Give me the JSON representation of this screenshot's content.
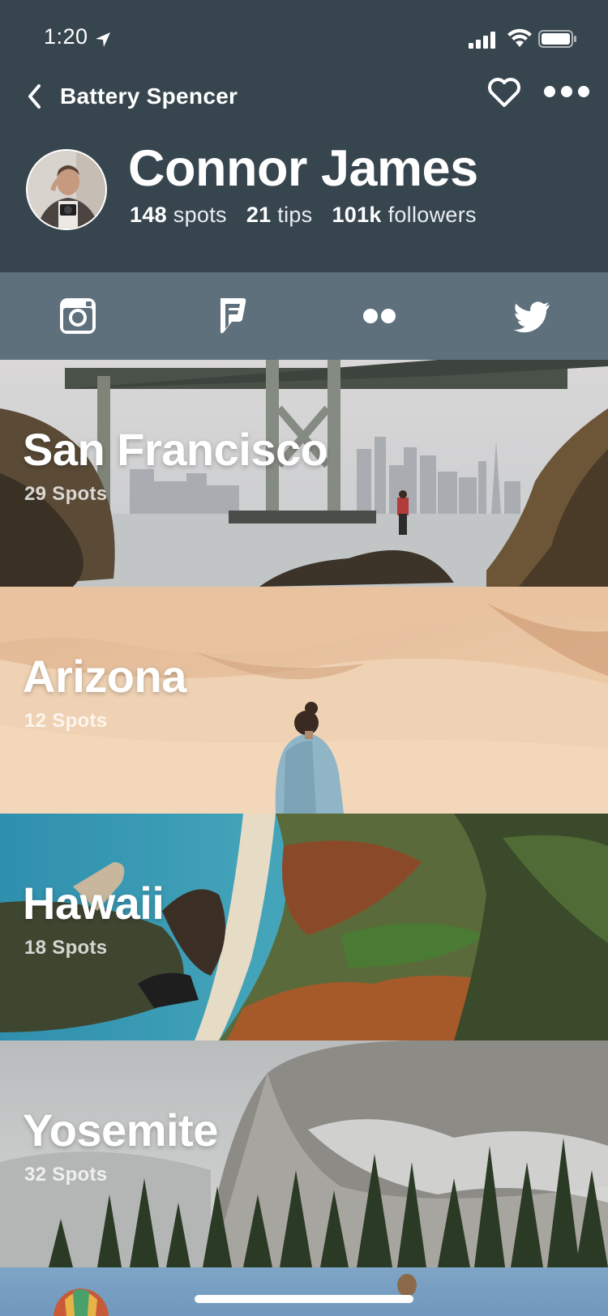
{
  "status_bar": {
    "time": "1:20"
  },
  "nav": {
    "back_label": "Battery Spencer"
  },
  "profile": {
    "name": "Connor James",
    "stats": [
      {
        "value": "148",
        "label": "spots"
      },
      {
        "value": "21",
        "label": "tips"
      },
      {
        "value": "101k",
        "label": "followers"
      }
    ]
  },
  "social": [
    {
      "icon": "instagram-icon"
    },
    {
      "icon": "foursquare-icon"
    },
    {
      "icon": "flickr-icon"
    },
    {
      "icon": "twitter-icon"
    }
  ],
  "cards": [
    {
      "title": "San Francisco",
      "subtitle": "29 Spots"
    },
    {
      "title": "Arizona",
      "subtitle": "12 Spots"
    },
    {
      "title": "Hawaii",
      "subtitle": "18 Spots"
    },
    {
      "title": "Yosemite",
      "subtitle": "32 Spots"
    }
  ],
  "colors": {
    "header": "#37454e",
    "social_bar": "#5e707b"
  }
}
